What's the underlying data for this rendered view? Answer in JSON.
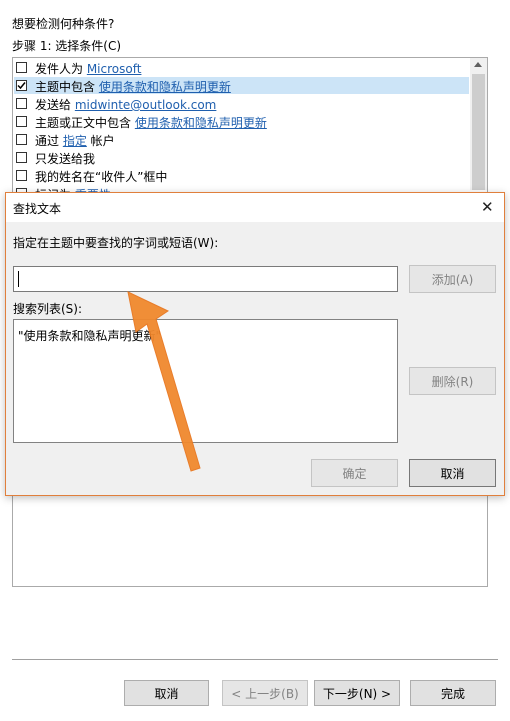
{
  "wizard": {
    "question": "想要检测何种条件?",
    "step_label": "步骤 1: 选择条件(C)",
    "conditions": [
      {
        "prefix": "发件人为 ",
        "link": "Microsoft",
        "suffix": "",
        "checked": false,
        "selected": false
      },
      {
        "prefix": "主题中包含 ",
        "link": "使用条款和隐私声明更新",
        "suffix": "",
        "checked": true,
        "selected": true
      },
      {
        "prefix": "发送给 ",
        "link": "midwinte@outlook.com",
        "suffix": "",
        "checked": false,
        "selected": false
      },
      {
        "prefix": "主题或正文中包含 ",
        "link": "使用条款和隐私声明更新",
        "suffix": "",
        "checked": false,
        "selected": false
      },
      {
        "prefix": "通过 ",
        "link": "指定",
        "suffix": " 帐户",
        "checked": false,
        "selected": false
      },
      {
        "prefix": "只发送给我",
        "link": "",
        "suffix": "",
        "checked": false,
        "selected": false
      },
      {
        "prefix": "我的姓名在“收件人”框中",
        "link": "",
        "suffix": "",
        "checked": false,
        "selected": false
      },
      {
        "prefix": "标记为 ",
        "link": "重要性",
        "suffix": "",
        "checked": false,
        "selected": false
      }
    ],
    "buttons": {
      "cancel": "取消",
      "back": "< 上一步(B)",
      "next": "下一步(N) >",
      "finish": "完成"
    }
  },
  "dialog": {
    "title": "查找文本",
    "close_glyph": "✕",
    "prompt_label": "指定在主题中要查找的字词或短语(W):",
    "input_value": "",
    "add_button": "添加(A)",
    "search_list_label": "搜索列表(S):",
    "search_list_items": [
      "\"使用条款和隐私声明更新\""
    ],
    "delete_button": "删除(R)",
    "ok_button": "确定",
    "cancel_button": "取消"
  },
  "colors": {
    "accent_arrow": "#f0892e",
    "link": "#1f5fae",
    "selection": "#cce4f7",
    "dialog_border": "#e07f3c"
  }
}
